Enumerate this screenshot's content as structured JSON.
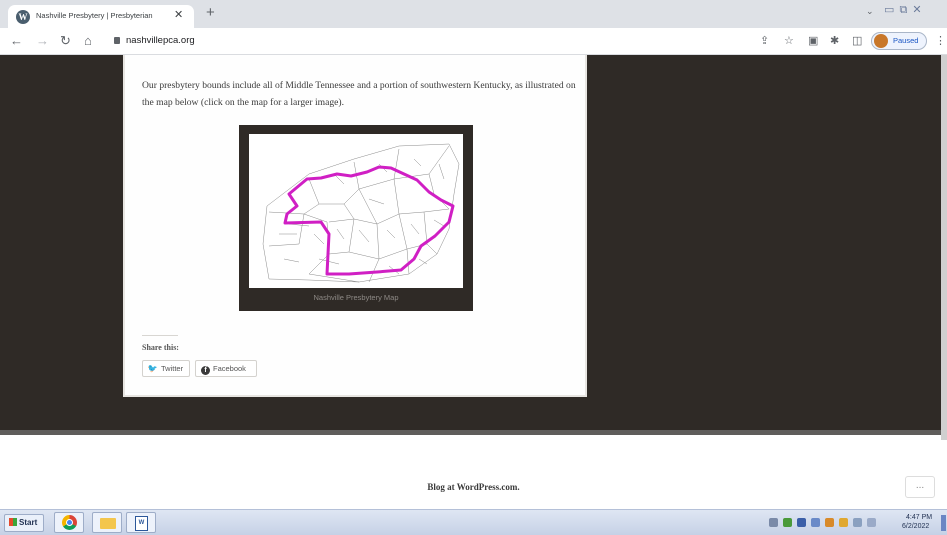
{
  "browser": {
    "tab": {
      "title": "Nashville Presbytery | Presbyterian",
      "favicon": "wordpress-icon"
    },
    "address": {
      "url": "nashvillepca.org"
    },
    "profile": {
      "status": "Paused"
    }
  },
  "page": {
    "intro": "Our presbytery bounds include all of Middle Tennessee and a portion of southwestern Kentucky, as illustrated on the map below (click on the map for a larger image).",
    "map": {
      "caption": "Nashville Presbytery Map",
      "boundary_color": "#d01fc4"
    },
    "share": {
      "label": "Share this:",
      "buttons": [
        "Twitter",
        "Facebook"
      ]
    },
    "footer": {
      "credit": "Blog at WordPress.com.",
      "more": "..."
    }
  },
  "taskbar": {
    "start_label": "Start",
    "apps": [
      "chrome-icon",
      "folder-icon",
      "word-icon"
    ],
    "clock": {
      "time": "4:47 PM",
      "date": "6/2/2022"
    }
  },
  "colors": {
    "page_background": "#2f2a26",
    "content_background": "#fefefe",
    "link_blue": "#1a56c4"
  }
}
